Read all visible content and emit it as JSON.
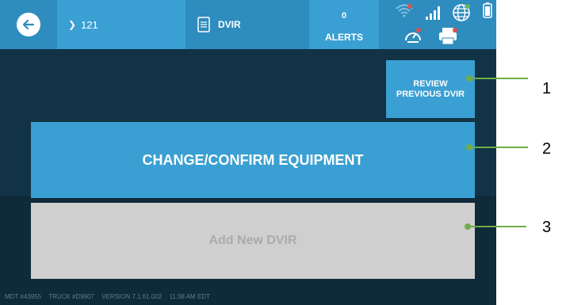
{
  "header": {
    "breadcrumb": "121",
    "tab_label": "DVIR",
    "alerts_count": "0",
    "alerts_label": "ALERTS",
    "icons": [
      "back-arrow-icon",
      "document-icon",
      "wifi-icon",
      "signal-bars-icon",
      "globe-icon",
      "battery-icon",
      "dashboard-icon",
      "printer-icon"
    ]
  },
  "buttons": {
    "review_label": "REVIEW\nPREVIOUS DVIR",
    "change_label": "CHANGE/CONFIRM EQUIPMENT",
    "add_label": "Add New DVIR"
  },
  "footer": {
    "mdt": "MDT #43955",
    "truck": "TRUCK #D9907",
    "version": "VERSION  7.1.61.002",
    "time": "11:38 AM EDT"
  },
  "callouts": [
    "1",
    "2",
    "3"
  ],
  "colors": {
    "header_blue": "#2e8cbf",
    "button_blue": "#3a9fd2",
    "disabled_gray": "#cfcfcf",
    "background_dark": "#123345",
    "callout_green": "#70ad47"
  }
}
